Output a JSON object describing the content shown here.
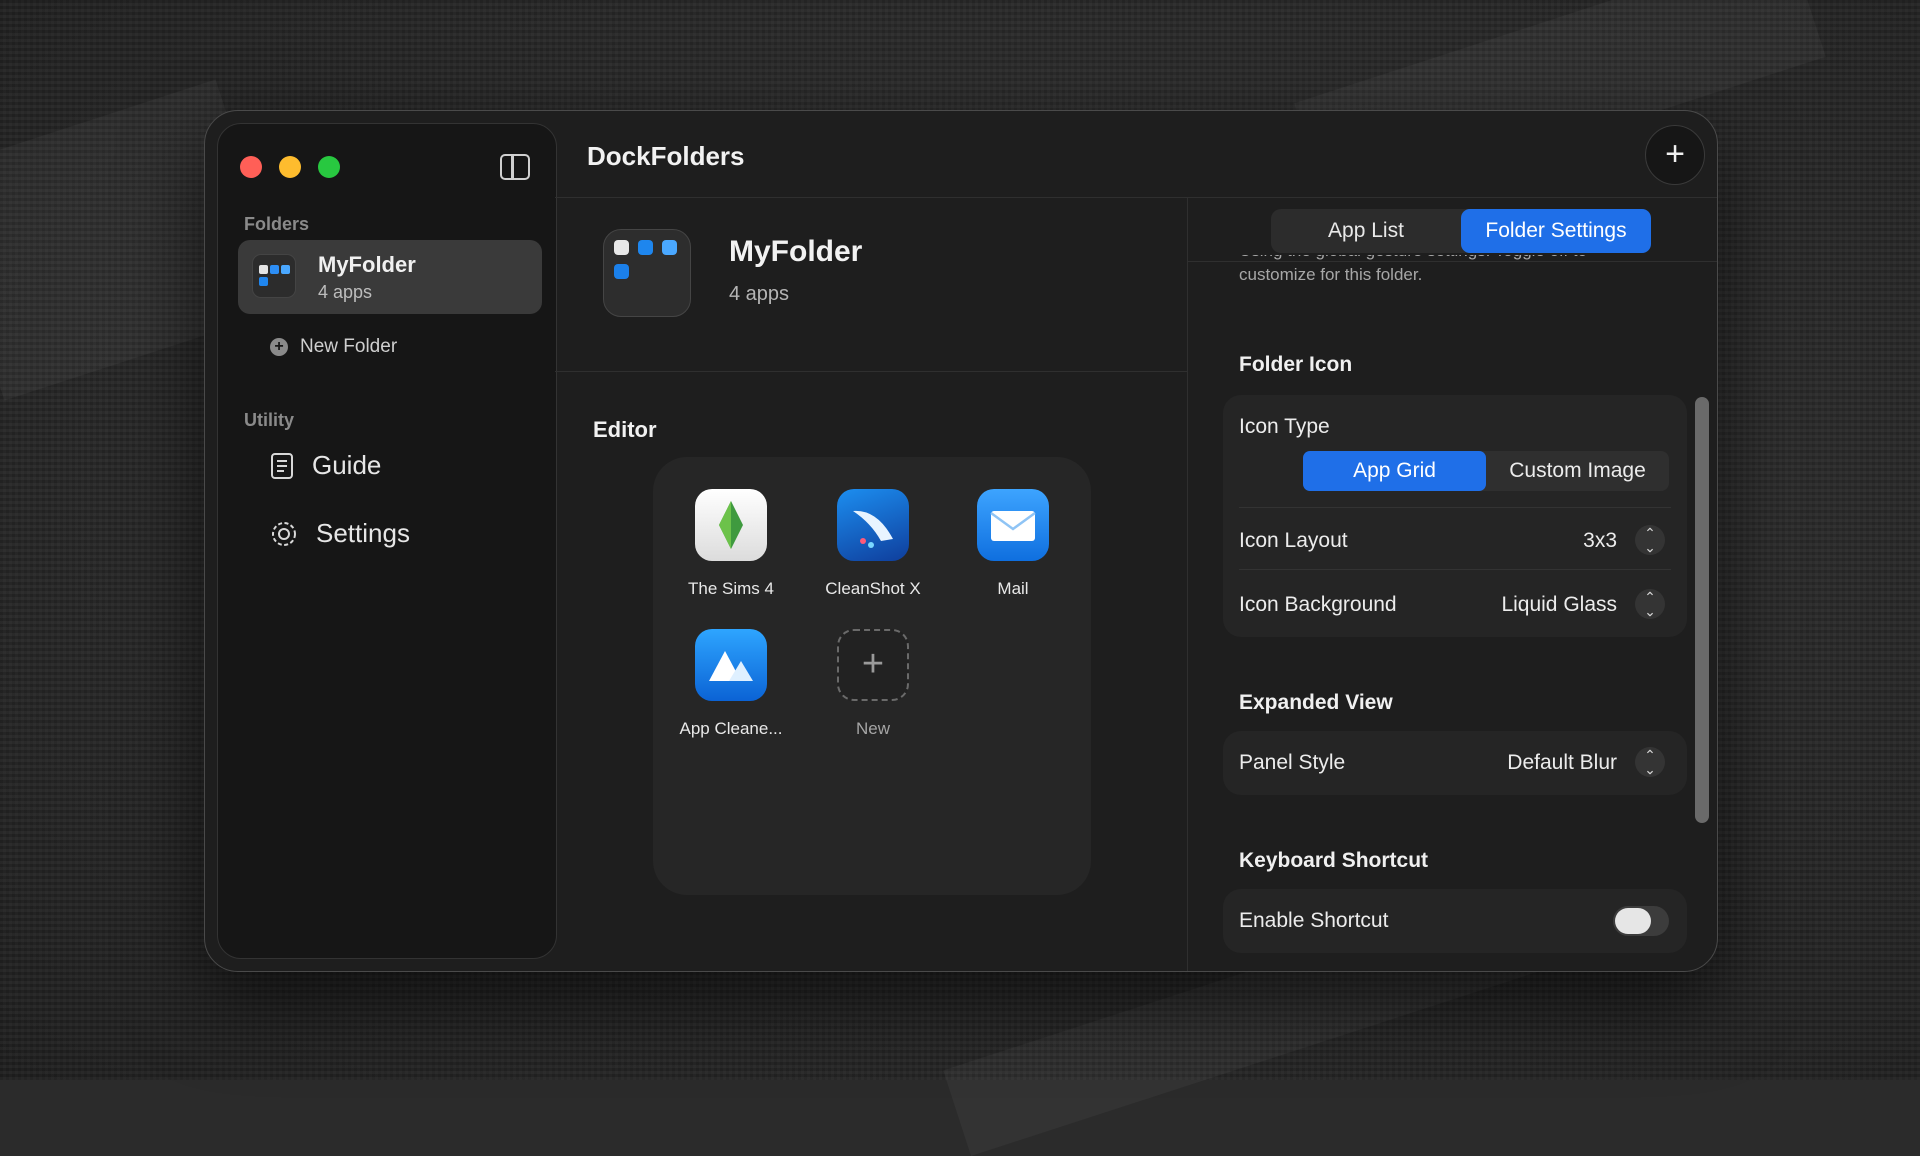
{
  "window_title": "DockFolders",
  "sidebar": {
    "folders_label": "Folders",
    "folder": {
      "name": "MyFolder",
      "count": "4 apps"
    },
    "new_folder_label": "New Folder",
    "utility_label": "Utility",
    "utility_items": [
      {
        "label": "Guide",
        "icon": "book-icon"
      },
      {
        "label": "Settings",
        "icon": "gear-icon"
      }
    ]
  },
  "folder_header": {
    "name": "MyFolder",
    "count": "4 apps"
  },
  "editor": {
    "label": "Editor",
    "apps": [
      {
        "name": "The Sims 4"
      },
      {
        "name": "CleanShot X"
      },
      {
        "name": "Mail"
      },
      {
        "name": "App Cleane..."
      },
      {
        "name": "New"
      }
    ]
  },
  "tabs": {
    "app_list": "App List",
    "folder_settings": "Folder Settings",
    "active": "Folder Settings"
  },
  "settings": {
    "help_text_partial": "Using the global gesture settings. Toggle off to",
    "help_text": "customize for this folder.",
    "folder_icon": {
      "title": "Folder Icon",
      "icon_type_label": "Icon Type",
      "icon_type_options": [
        "App Grid",
        "Custom Image"
      ],
      "icon_type_selected": "App Grid",
      "icon_layout_label": "Icon Layout",
      "icon_layout_value": "3x3",
      "icon_background_label": "Icon Background",
      "icon_background_value": "Liquid Glass"
    },
    "expanded_view": {
      "title": "Expanded View",
      "panel_style_label": "Panel Style",
      "panel_style_value": "Default Blur"
    },
    "keyboard_shortcut": {
      "title": "Keyboard Shortcut",
      "enable_label": "Enable Shortcut",
      "enabled": false
    }
  },
  "colors": {
    "accent": "#1f6fe8",
    "close": "#ff5f57",
    "minimize": "#febc2e",
    "zoom": "#28c840"
  }
}
